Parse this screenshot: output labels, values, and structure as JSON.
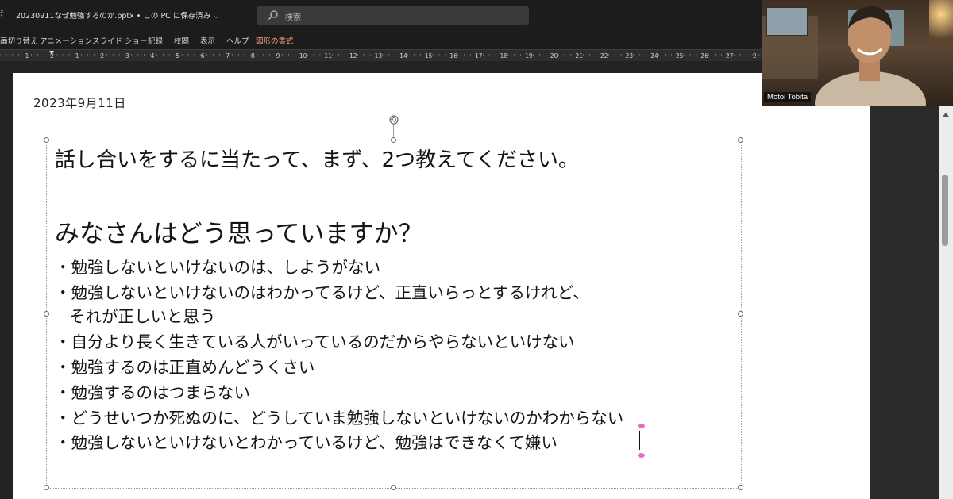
{
  "titlebar": {
    "document_title": "20230911なぜ勉強するのか.pptx • この PC に保存済み",
    "search_placeholder": "検索"
  },
  "ribbon": {
    "tabs": [
      {
        "label": "画切り替え"
      },
      {
        "label": "アニメーション"
      },
      {
        "label": "スライド ショー"
      },
      {
        "label": "記録"
      },
      {
        "label": "校閲"
      },
      {
        "label": "表示"
      },
      {
        "label": "ヘルプ"
      },
      {
        "label": "図形の書式",
        "active": true
      }
    ]
  },
  "ruler": {
    "labels": [
      "1",
      "2",
      "1",
      "2",
      "3",
      "4",
      "5",
      "6",
      "7",
      "8",
      "9",
      "10",
      "11",
      "12",
      "13",
      "14",
      "15",
      "16",
      "17",
      "18",
      "19",
      "20",
      "21",
      "22",
      "23",
      "24",
      "25",
      "26",
      "27",
      "2"
    ]
  },
  "slide": {
    "date": "2023年9月11日",
    "heading1": "話し合いをするに当たって、まず、2つ教えてください。",
    "heading2": "みなさんはどう思っていますか？",
    "bullets": [
      "・勉強しないといけないのは、しようがない",
      "・勉強しないといけないのはわかってるけど、正直いらっとするけれど、",
      "それが正しいと思う",
      "・自分より長く生きている人がいっているのだからやらないといけない",
      "・勉強するのは正直めんどうくさい",
      "・勉強するのはつまらない",
      "・どうせいつか死ぬのに、どうしていま勉強しないといけないのかわからない",
      "・勉強しないといけないとわかっているけど、勉強はできなくて嫌い"
    ]
  },
  "video": {
    "participant_name": "Motoi Tobita"
  },
  "colors": {
    "active_tab": "#f0a07a",
    "app_background": "#1c1c1c",
    "slide_background": "#ffffff"
  }
}
